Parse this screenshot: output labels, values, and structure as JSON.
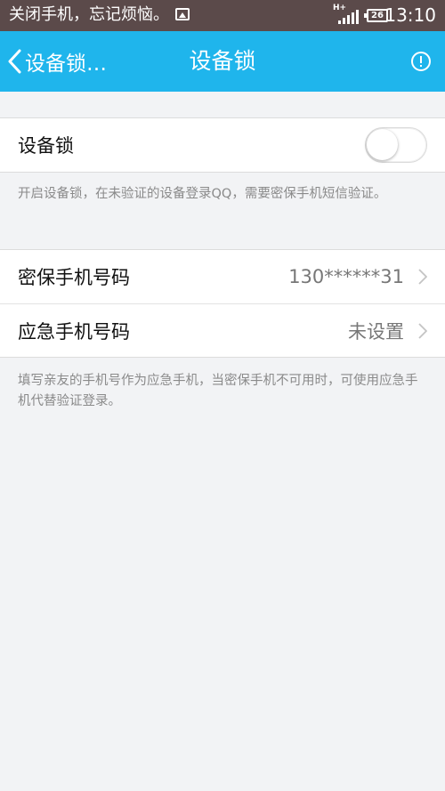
{
  "status_bar": {
    "ticker_text": "关闭手机，忘记烦恼。",
    "network": "H+",
    "battery": "26",
    "time": "13:10"
  },
  "nav": {
    "back_label": "设备锁…",
    "title": "设备锁"
  },
  "device_lock": {
    "label": "设备锁",
    "enabled": false,
    "description": "开启设备锁，在未验证的设备登录QQ，需要密保手机短信验证。"
  },
  "phones": {
    "security_phone": {
      "label": "密保手机号码",
      "value": "130******31"
    },
    "emergency_phone": {
      "label": "应急手机号码",
      "value": "未设置"
    },
    "description": "填写亲友的手机号作为应急手机，当密保手机不可用时，可使用应急手机代替验证登录。"
  },
  "colors": {
    "nav_background": "#1fb5ec",
    "status_background": "#5b4a4a",
    "page_background": "#f2f3f5"
  }
}
